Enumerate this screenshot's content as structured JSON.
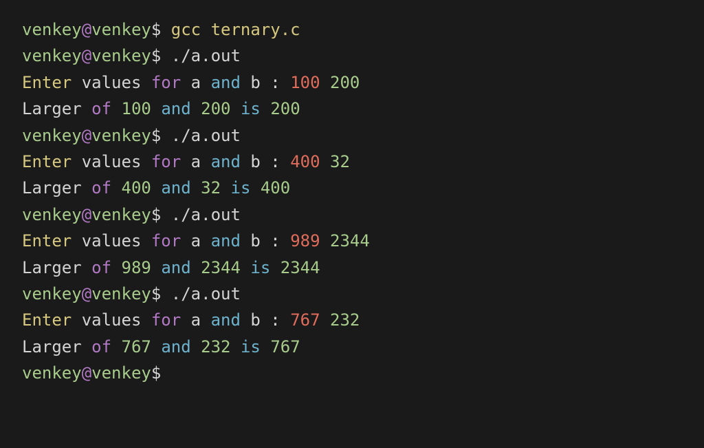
{
  "prompt": {
    "user": "venkey",
    "at": "@",
    "host": "venkey",
    "dollar": "$"
  },
  "commands": {
    "compile": "gcc ternary.c",
    "run": "./a.out"
  },
  "runs": [
    {
      "a": "100",
      "b": "200",
      "larger": "200"
    },
    {
      "a": "400",
      "b": "32",
      "larger": "400"
    },
    {
      "a": "989",
      "b": "2344",
      "larger": "2344"
    },
    {
      "a": "767",
      "b": "232",
      "larger": "767"
    }
  ],
  "text": {
    "enter": "Enter",
    "values": "values",
    "for": "for",
    "a": "a",
    "and": "and",
    "b": "b",
    "colon": ":",
    "larger": "Larger",
    "of": "of",
    "is": "is",
    "space": " "
  }
}
